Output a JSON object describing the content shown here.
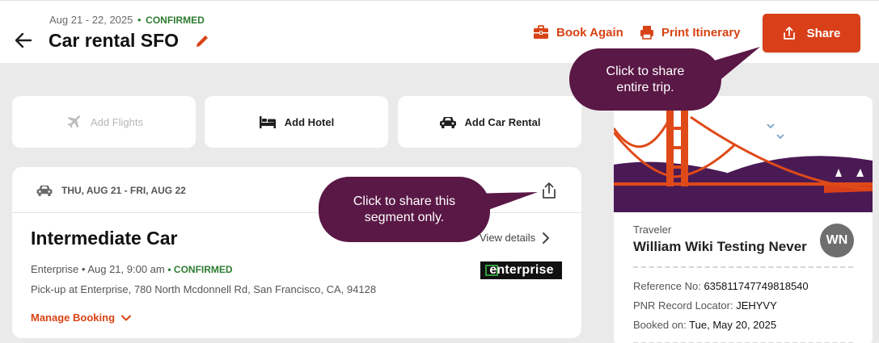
{
  "header": {
    "dates": "Aug 21 - 22, 2025",
    "status": "CONFIRMED",
    "title": "Car rental SFO",
    "book_again": "Book Again",
    "print_itinerary": "Print Itinerary",
    "share": "Share"
  },
  "add_options": [
    {
      "label": "Add Flights",
      "icon": "plane-icon",
      "enabled": false
    },
    {
      "label": "Add Hotel",
      "icon": "bed-icon",
      "enabled": true
    },
    {
      "label": "Add Car Rental",
      "icon": "car-icon",
      "enabled": true
    }
  ],
  "segment": {
    "date_range": "THU, AUG 21 - FRI, AUG 22",
    "title": "Intermediate Car",
    "view_details": "View details",
    "vendor": "Enterprise",
    "pickup_time": "Aug 21, 9:00 am",
    "status": "CONFIRMED",
    "pickup_address": "Pick-up at Enterprise, 780 North Mcdonnell Rd, San Francisco, CA, 94128",
    "logo_text": "enterprise",
    "manage_booking": "Manage Booking"
  },
  "traveler": {
    "label": "Traveler",
    "name": "William Wiki Testing Never",
    "initials": "WN",
    "reference_label": "Reference No:",
    "reference_value": "635811747749818540",
    "pnr_label": "PNR Record Locator:",
    "pnr_value": "JEHYVY",
    "booked_label": "Booked on:",
    "booked_value": "Tue, May 20, 2025"
  },
  "tooltips": {
    "trip": "Click to share entire trip.",
    "segment": "Click to share this segment only."
  },
  "colors": {
    "accent": "#d9401a",
    "confirmed": "#2e7d32",
    "tooltip_bg": "#5a1846"
  }
}
